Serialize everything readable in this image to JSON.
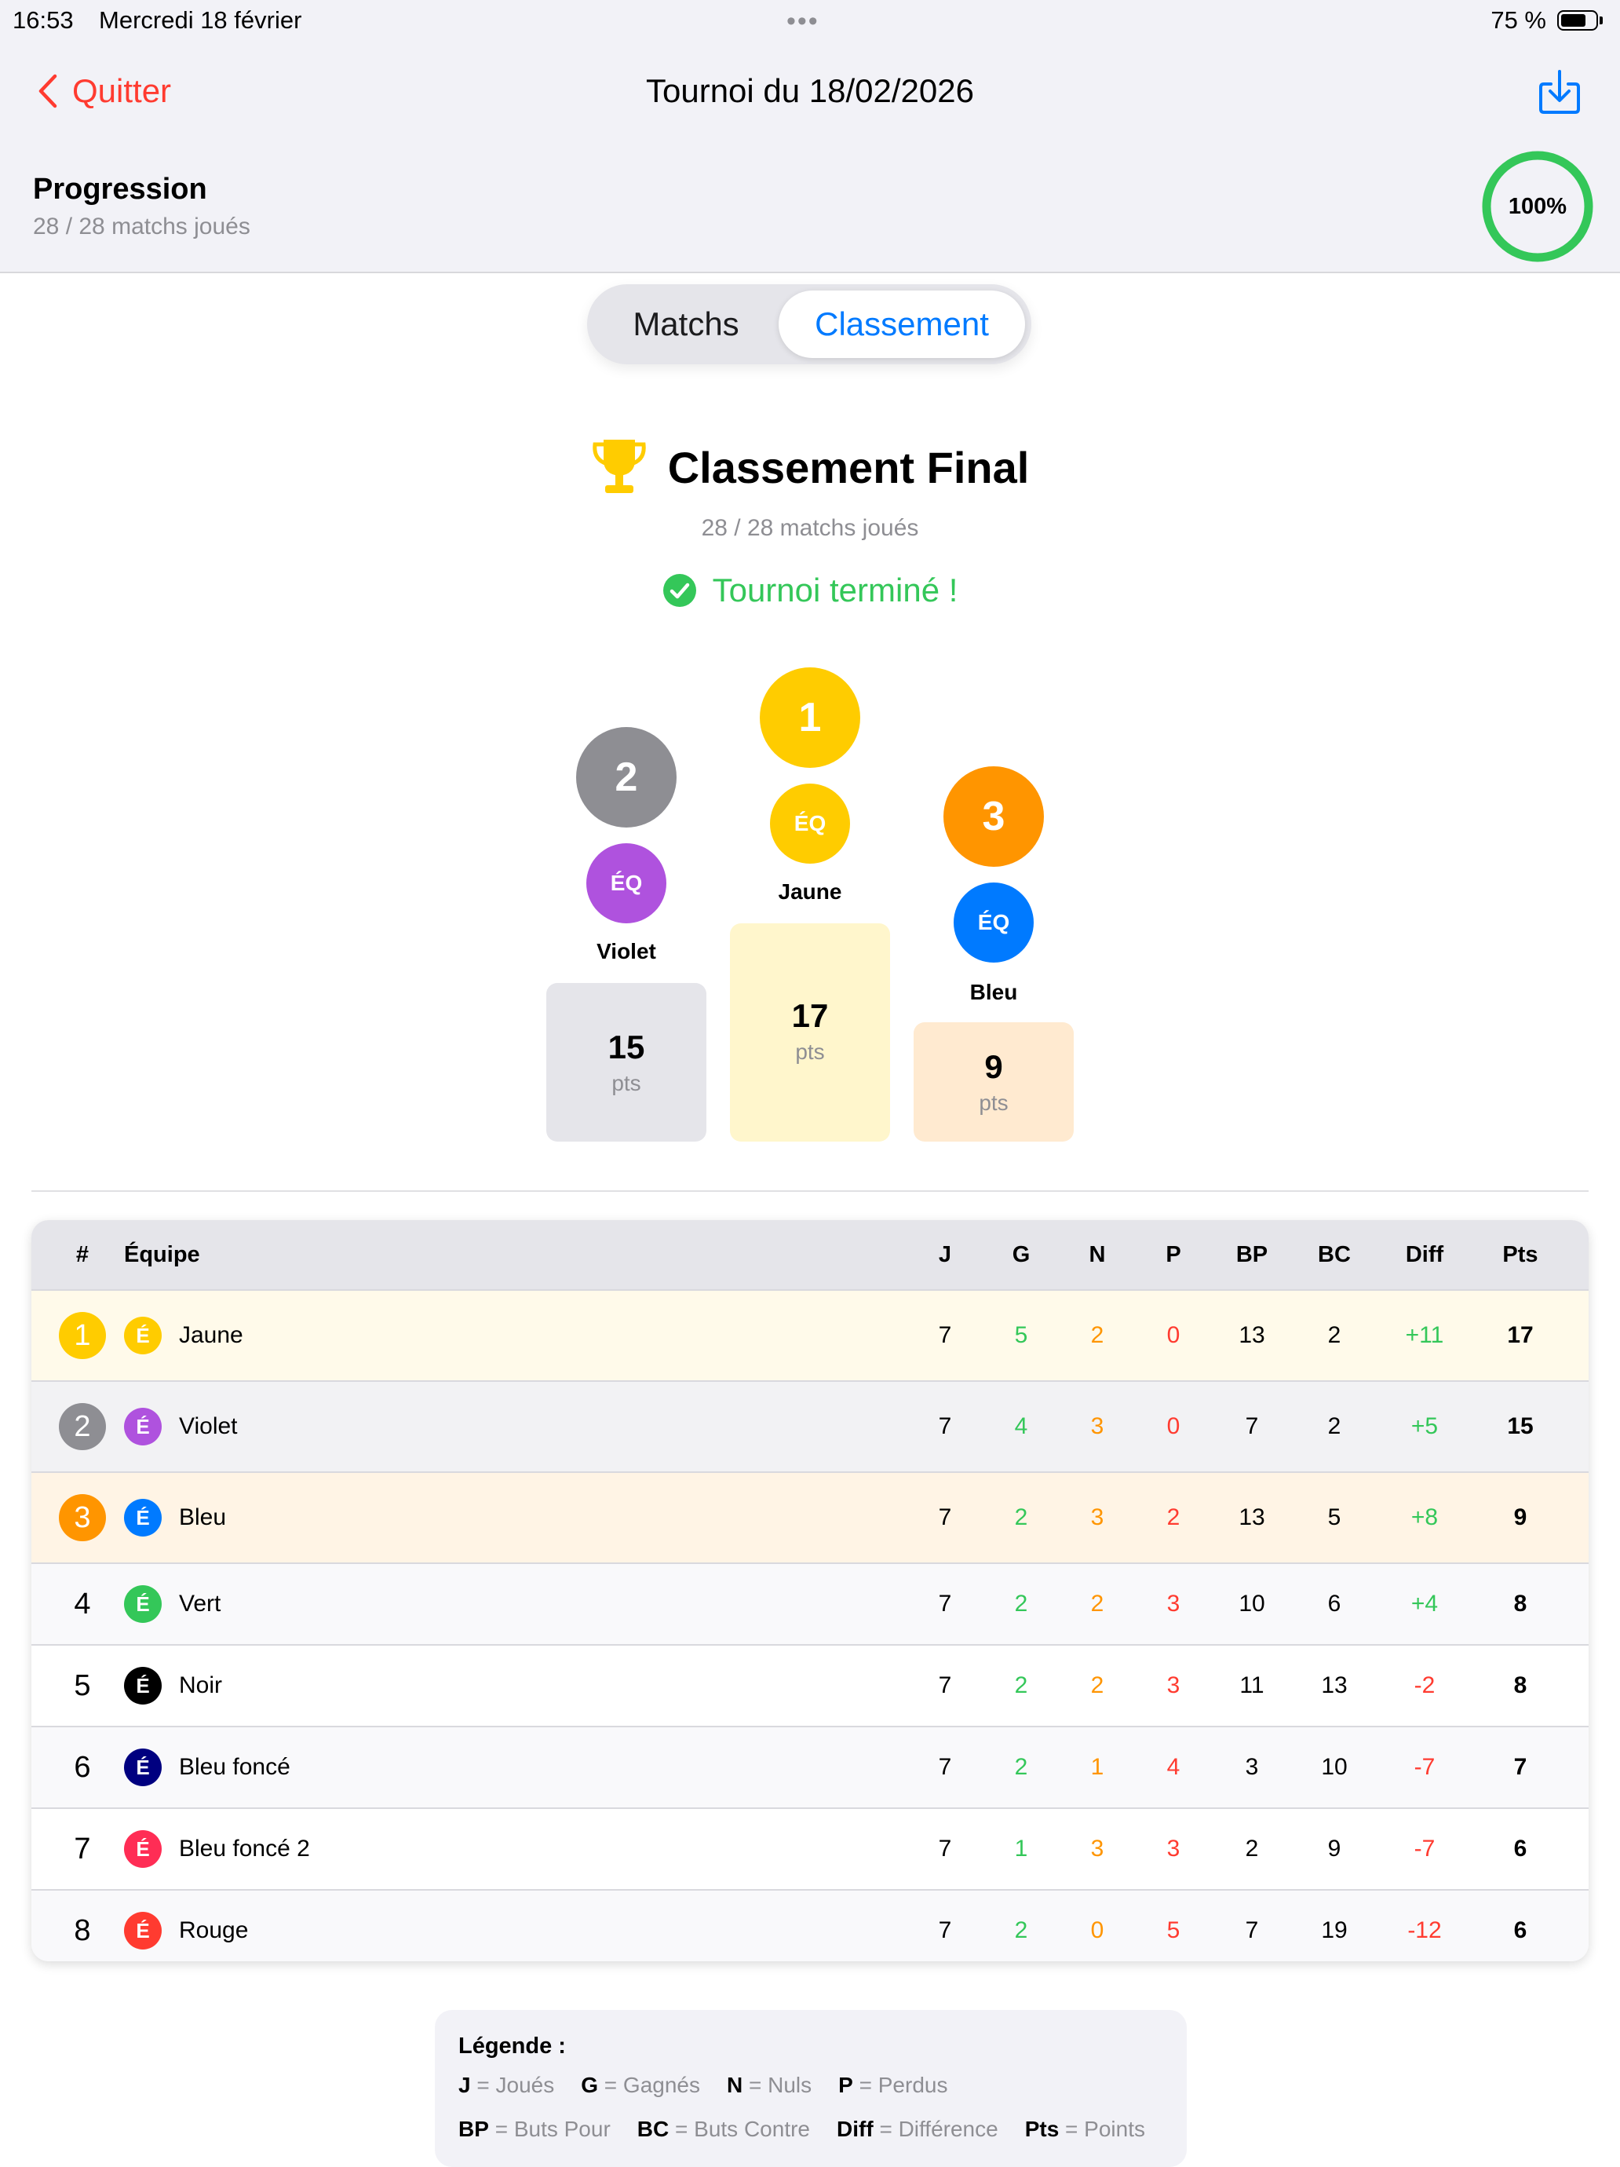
{
  "status_bar": {
    "time": "16:53",
    "date": "Mercredi 18 février",
    "dots": "•••",
    "battery_text": "75 %",
    "battery_level": 0.75
  },
  "nav": {
    "back_label": "Quitter",
    "title": "Tournoi du 18/02/2026",
    "export_icon": "download-tray-icon"
  },
  "progress": {
    "title": "Progression",
    "subtitle": "28 / 28 matchs joués",
    "percent_label": "100%",
    "percent": 100
  },
  "tabs": [
    {
      "label": "Matchs",
      "active": false
    },
    {
      "label": "Classement",
      "active": true
    }
  ],
  "standings": {
    "title": "Classement Final",
    "subtitle": "28 / 28 matchs joués",
    "status": "Tournoi terminé !"
  },
  "podium": [
    {
      "rank": "2",
      "avatar": "ÉQ",
      "name": "Violet",
      "points": "15",
      "points_label": "pts",
      "rank_color": "#8e8e93",
      "team_color": "#af52de",
      "box_color": "#e5e5ea"
    },
    {
      "rank": "1",
      "avatar": "ÉQ",
      "name": "Jaune",
      "points": "17",
      "points_label": "pts",
      "rank_color": "#ffcc00",
      "team_color": "#ffcc00",
      "box_color": "#fff6cc"
    },
    {
      "rank": "3",
      "avatar": "ÉQ",
      "name": "Bleu",
      "points": "9",
      "points_label": "pts",
      "rank_color": "#ff9500",
      "team_color": "#007aff",
      "box_color": "#ffead0"
    }
  ],
  "table": {
    "headers": {
      "rank": "#",
      "team": "Équipe",
      "j": "J",
      "g": "G",
      "n": "N",
      "p": "P",
      "bp": "BP",
      "bc": "BC",
      "diff": "Diff",
      "pts": "Pts"
    },
    "rows": [
      {
        "rank": "1",
        "initial": "É",
        "team": "Jaune",
        "j": "7",
        "g": "5",
        "n": "2",
        "p": "0",
        "bp": "13",
        "bc": "2",
        "diff": "+11",
        "pts": "17",
        "team_color": "#ffcc00",
        "badge_color": "#ffcc00",
        "row_bg": "#fffaea"
      },
      {
        "rank": "2",
        "initial": "É",
        "team": "Violet",
        "j": "7",
        "g": "4",
        "n": "3",
        "p": "0",
        "bp": "7",
        "bc": "2",
        "diff": "+5",
        "pts": "15",
        "team_color": "#af52de",
        "badge_color": "#8e8e93",
        "row_bg": "#f2f2f4"
      },
      {
        "rank": "3",
        "initial": "É",
        "team": "Bleu",
        "j": "7",
        "g": "2",
        "n": "3",
        "p": "2",
        "bp": "13",
        "bc": "5",
        "diff": "+8",
        "pts": "9",
        "team_color": "#007aff",
        "badge_color": "#ff9500",
        "row_bg": "#fff4e5"
      },
      {
        "rank": "4",
        "initial": "É",
        "team": "Vert",
        "j": "7",
        "g": "2",
        "n": "2",
        "p": "3",
        "bp": "10",
        "bc": "6",
        "diff": "+4",
        "pts": "8",
        "team_color": "#34c759",
        "badge_color": "",
        "row_bg": "#f9f9fb"
      },
      {
        "rank": "5",
        "initial": "É",
        "team": "Noir",
        "j": "7",
        "g": "2",
        "n": "2",
        "p": "3",
        "bp": "11",
        "bc": "13",
        "diff": "-2",
        "pts": "8",
        "team_color": "#000000",
        "badge_color": "",
        "row_bg": "#ffffff"
      },
      {
        "rank": "6",
        "initial": "É",
        "team": "Bleu foncé",
        "j": "7",
        "g": "2",
        "n": "1",
        "p": "4",
        "bp": "3",
        "bc": "10",
        "diff": "-7",
        "pts": "7",
        "team_color": "#000080",
        "badge_color": "",
        "row_bg": "#f9f9fb"
      },
      {
        "rank": "7",
        "initial": "É",
        "team": "Bleu foncé 2",
        "j": "7",
        "g": "1",
        "n": "3",
        "p": "3",
        "bp": "2",
        "bc": "9",
        "diff": "-7",
        "pts": "6",
        "team_color": "#ff2d55",
        "badge_color": "",
        "row_bg": "#ffffff"
      },
      {
        "rank": "8",
        "initial": "É",
        "team": "Rouge",
        "j": "7",
        "g": "2",
        "n": "0",
        "p": "5",
        "bp": "7",
        "bc": "19",
        "diff": "-12",
        "pts": "6",
        "team_color": "#ff3b30",
        "badge_color": "",
        "row_bg": "#f9f9fb"
      }
    ]
  },
  "legend": {
    "title": "Légende :",
    "row1": [
      {
        "key": "J",
        "desc": "= Joués"
      },
      {
        "key": "G",
        "desc": "= Gagnés"
      },
      {
        "key": "N",
        "desc": "= Nuls"
      },
      {
        "key": "P",
        "desc": "= Perdus"
      }
    ],
    "row2": [
      {
        "key": "BP",
        "desc": "= Buts Pour"
      },
      {
        "key": "BC",
        "desc": "= Buts Contre"
      },
      {
        "key": "Diff",
        "desc": "= Différence"
      },
      {
        "key": "Pts",
        "desc": "= Points"
      }
    ]
  }
}
